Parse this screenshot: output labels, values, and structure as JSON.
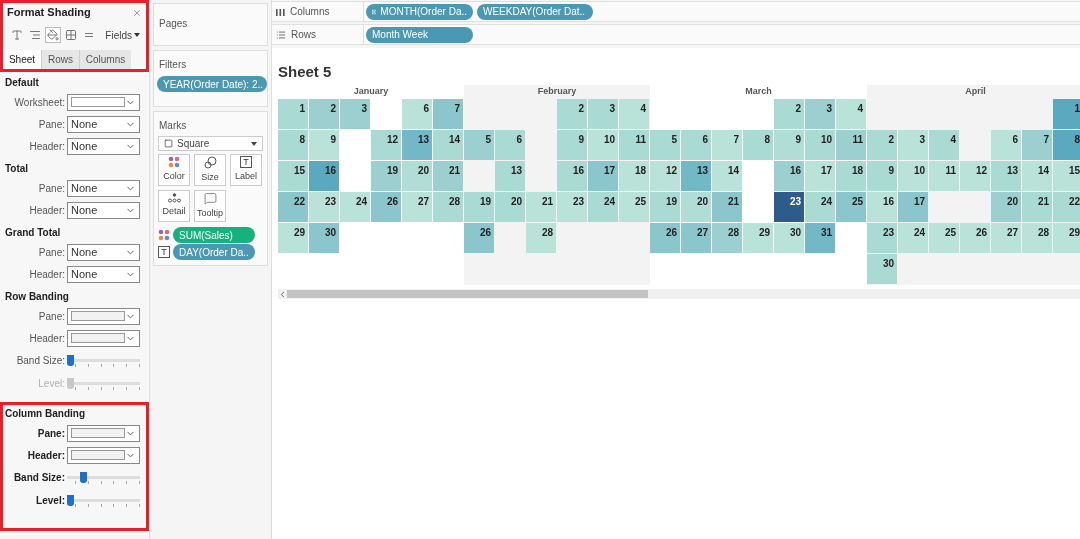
{
  "format_panel": {
    "title": "Format Shading",
    "highlighted": true,
    "toolbar": [
      {
        "kind": "font",
        "selected": false
      },
      {
        "kind": "alignment",
        "selected": false
      },
      {
        "kind": "shading",
        "selected": true
      },
      {
        "kind": "borders",
        "selected": false
      },
      {
        "kind": "lines",
        "selected": false
      }
    ],
    "fields_menu": "Fields",
    "tabs": [
      {
        "label": "Sheet",
        "selected": true
      },
      {
        "label": "Rows",
        "selected": false
      },
      {
        "label": "Columns",
        "selected": false
      }
    ],
    "sections": [
      {
        "heading": "Default",
        "highlighted": false,
        "rows": [
          {
            "kind": "swatch",
            "label": "Worksheet:",
            "color": "#ffffff"
          },
          {
            "kind": "select",
            "label": "Pane:",
            "value": "None"
          },
          {
            "kind": "select",
            "label": "Header:",
            "value": "None"
          }
        ]
      },
      {
        "heading": "Total",
        "highlighted": false,
        "rows": [
          {
            "kind": "select",
            "label": "Pane:",
            "value": "None"
          },
          {
            "kind": "select",
            "label": "Header:",
            "value": "None"
          }
        ]
      },
      {
        "heading": "Grand Total",
        "highlighted": false,
        "rows": [
          {
            "kind": "select",
            "label": "Pane:",
            "value": "None"
          },
          {
            "kind": "select",
            "label": "Header:",
            "value": "None"
          }
        ]
      },
      {
        "heading": "Row Banding",
        "highlighted": false,
        "rows": [
          {
            "kind": "swatch",
            "label": "Pane:",
            "color": "#f2f2f2"
          },
          {
            "kind": "swatch",
            "label": "Header:",
            "color": "#f2f2f2"
          },
          {
            "kind": "slider",
            "label": "Band Size:",
            "level": 0,
            "disabled": false
          },
          {
            "kind": "slider",
            "label": "Level:",
            "level": 0,
            "disabled": true
          }
        ]
      },
      {
        "heading": "Column Banding",
        "highlighted": true,
        "rows": [
          {
            "kind": "swatch",
            "label": "Pane:",
            "color": "#f2f2f2"
          },
          {
            "kind": "swatch",
            "label": "Header:",
            "color": "#f2f2f2"
          },
          {
            "kind": "slider",
            "label": "Band Size:",
            "level": 0.2,
            "disabled": false
          },
          {
            "kind": "slider",
            "label": "Level:",
            "level": 0,
            "disabled": false
          }
        ]
      }
    ]
  },
  "pages": {
    "title": "Pages"
  },
  "filters": {
    "title": "Filters",
    "pills": [
      "YEAR(Order Date): 2.."
    ]
  },
  "marks": {
    "title": "Marks",
    "mark_type": "Square",
    "buttons": [
      {
        "kind": "color",
        "label": "Color"
      },
      {
        "kind": "size",
        "label": "Size"
      },
      {
        "kind": "label",
        "label": "Label"
      },
      {
        "kind": "detail",
        "label": "Detail"
      },
      {
        "kind": "tooltip",
        "label": "Tooltip"
      }
    ],
    "pills": [
      {
        "kind": "color",
        "label": "SUM(Sales)",
        "color": "#16b27e"
      },
      {
        "kind": "label",
        "label": "DAY(Order Da..",
        "color": "#4b98b3"
      }
    ]
  },
  "shelves": [
    {
      "kind": "columns",
      "label": "Columns",
      "pills": [
        {
          "label": "MONTH(Order Da..",
          "expandable": true
        },
        {
          "label": "WEEKDAY(Order Dat..",
          "expandable": false
        }
      ]
    },
    {
      "kind": "rows",
      "label": "Rows",
      "pills": [
        {
          "label": "Month Week",
          "expandable": false
        }
      ]
    }
  ],
  "sheet_title": "Sheet 5",
  "calendar": [
    {
      "month": "January",
      "banded": false,
      "rows": [
        [
          {
            "day": "1",
            "color": "#a9dad3"
          },
          {
            "day": "2",
            "color": "#9ccfcf"
          },
          {
            "day": "3",
            "color": "#9ccfcf"
          },
          null,
          {
            "day": "6",
            "color": "#b9e3d8"
          },
          {
            "day": "7",
            "color": "#8ac6cc"
          }
        ],
        [
          {
            "day": "8",
            "color": "#a9dad3"
          },
          {
            "day": "9",
            "color": "#b9e3d8"
          },
          null,
          {
            "day": "12",
            "color": "#a9dad3"
          },
          {
            "day": "13",
            "color": "#72b8c7"
          },
          {
            "day": "14",
            "color": "#a9dad3"
          }
        ],
        [
          {
            "day": "15",
            "color": "#a9dad3"
          },
          {
            "day": "16",
            "color": "#5ba9bf"
          },
          null,
          {
            "day": "19",
            "color": "#9ccfcf"
          },
          {
            "day": "20",
            "color": "#b0ddd5"
          },
          {
            "day": "21",
            "color": "#9ccfcf"
          }
        ],
        [
          {
            "day": "22",
            "color": "#8ac6cc"
          },
          {
            "day": "23",
            "color": "#b9e3d8"
          },
          {
            "day": "24",
            "color": "#b9e3d8"
          },
          {
            "day": "26",
            "color": "#8ac6cc"
          },
          {
            "day": "27",
            "color": "#b9e3d8"
          },
          {
            "day": "28",
            "color": "#a9dad3"
          }
        ],
        [
          {
            "day": "29",
            "color": "#b9e3d8"
          },
          {
            "day": "30",
            "color": "#8ac6cc"
          },
          null,
          null,
          null,
          null
        ]
      ]
    },
    {
      "month": "February",
      "banded": true,
      "rows": [
        [
          null,
          null,
          null,
          {
            "day": "2",
            "color": "#a9dad3"
          },
          {
            "day": "3",
            "color": "#a9dad3"
          },
          {
            "day": "4",
            "color": "#b9e3d8"
          }
        ],
        [
          {
            "day": "5",
            "color": "#9ccfcf"
          },
          {
            "day": "6",
            "color": "#a9dad3"
          },
          null,
          {
            "day": "9",
            "color": "#a9dad3"
          },
          {
            "day": "10",
            "color": "#b9e3d8"
          },
          {
            "day": "11",
            "color": "#a9dad3"
          }
        ],
        [
          null,
          {
            "day": "13",
            "color": "#a9dad3"
          },
          null,
          {
            "day": "16",
            "color": "#a9dad3"
          },
          {
            "day": "17",
            "color": "#8ac6cc"
          },
          {
            "day": "18",
            "color": "#b9e3d8"
          }
        ],
        [
          {
            "day": "19",
            "color": "#a9dad3"
          },
          {
            "day": "20",
            "color": "#a9dad3"
          },
          {
            "day": "21",
            "color": "#b9e3d8"
          },
          {
            "day": "23",
            "color": "#b9e3d8"
          },
          {
            "day": "24",
            "color": "#a9dad3"
          },
          {
            "day": "25",
            "color": "#b9e3d8"
          }
        ],
        [
          {
            "day": "26",
            "color": "#8ac6cc"
          },
          null,
          {
            "day": "28",
            "color": "#b9e3d8"
          },
          null,
          null,
          null
        ]
      ]
    },
    {
      "month": "March",
      "banded": false,
      "rows": [
        [
          null,
          null,
          null,
          null,
          {
            "day": "2",
            "color": "#a9dad3"
          },
          {
            "day": "3",
            "color": "#9ccfcf"
          },
          {
            "day": "4",
            "color": "#b9e3d8"
          }
        ],
        [
          {
            "day": "5",
            "color": "#a9dad3"
          },
          {
            "day": "6",
            "color": "#a9dad3"
          },
          {
            "day": "7",
            "color": "#b9e3d8"
          },
          {
            "day": "8",
            "color": "#a9dad3"
          },
          {
            "day": "9",
            "color": "#b0ddd5"
          },
          {
            "day": "10",
            "color": "#a9dad3"
          },
          {
            "day": "11",
            "color": "#9ccfcf"
          }
        ],
        [
          {
            "day": "12",
            "color": "#b9e3d8"
          },
          {
            "day": "13",
            "color": "#72b8c7"
          },
          {
            "day": "14",
            "color": "#b9e3d8"
          },
          null,
          {
            "day": "16",
            "color": "#9ccfcf"
          },
          {
            "day": "17",
            "color": "#b9e3d8"
          },
          {
            "day": "18",
            "color": "#a9dad3"
          }
        ],
        [
          {
            "day": "19",
            "color": "#a9dad3"
          },
          {
            "day": "20",
            "color": "#b0ddd5"
          },
          {
            "day": "21",
            "color": "#8ac6cc"
          },
          null,
          {
            "day": "23",
            "color": "#2d5b8a"
          },
          {
            "day": "24",
            "color": "#a9dad3"
          },
          {
            "day": "25",
            "color": "#8ac6cc"
          }
        ],
        [
          {
            "day": "26",
            "color": "#8ac6cc"
          },
          {
            "day": "27",
            "color": "#8ac6cc"
          },
          {
            "day": "28",
            "color": "#9ccfcf"
          },
          {
            "day": "29",
            "color": "#b9e3d8"
          },
          {
            "day": "30",
            "color": "#b9e3d8"
          },
          {
            "day": "31",
            "color": "#72b8c7"
          },
          null
        ]
      ]
    },
    {
      "month": "April",
      "banded": true,
      "rows": [
        [
          null,
          null,
          null,
          null,
          null,
          null,
          {
            "day": "1",
            "color": "#5ba9bf"
          }
        ],
        [
          {
            "day": "2",
            "color": "#a9dad3"
          },
          {
            "day": "3",
            "color": "#b9e3d8"
          },
          {
            "day": "4",
            "color": "#a9dad3"
          },
          null,
          {
            "day": "6",
            "color": "#b9e3d8"
          },
          {
            "day": "7",
            "color": "#9ccfcf"
          },
          {
            "day": "8",
            "color": "#5ba9bf"
          }
        ],
        [
          {
            "day": "9",
            "color": "#a9dad3"
          },
          {
            "day": "10",
            "color": "#b9e3d8"
          },
          {
            "day": "11",
            "color": "#b9e3d8"
          },
          {
            "day": "12",
            "color": "#b9e3d8"
          },
          {
            "day": "13",
            "color": "#a9dad3"
          },
          {
            "day": "14",
            "color": "#b9e3d8"
          },
          {
            "day": "15",
            "color": "#b9e3d8"
          }
        ],
        [
          {
            "day": "16",
            "color": "#b9e3d8"
          },
          {
            "day": "17",
            "color": "#8ac6cc"
          },
          null,
          null,
          {
            "day": "20",
            "color": "#9ccfcf"
          },
          {
            "day": "21",
            "color": "#a9dad3"
          },
          {
            "day": "22",
            "color": "#a9dad3"
          }
        ],
        [
          {
            "day": "23",
            "color": "#a9dad3"
          },
          {
            "day": "24",
            "color": "#b9e3d8"
          },
          {
            "day": "25",
            "color": "#b9e3d8"
          },
          {
            "day": "26",
            "color": "#b9e3d8"
          },
          {
            "day": "27",
            "color": "#b9e3d8"
          },
          {
            "day": "28",
            "color": "#b9e3d8"
          },
          {
            "day": "29",
            "color": "#b9e3d8"
          }
        ],
        [
          {
            "day": "30",
            "color": "#a9dad3"
          },
          null,
          null,
          null,
          null,
          null,
          null
        ]
      ]
    }
  ]
}
